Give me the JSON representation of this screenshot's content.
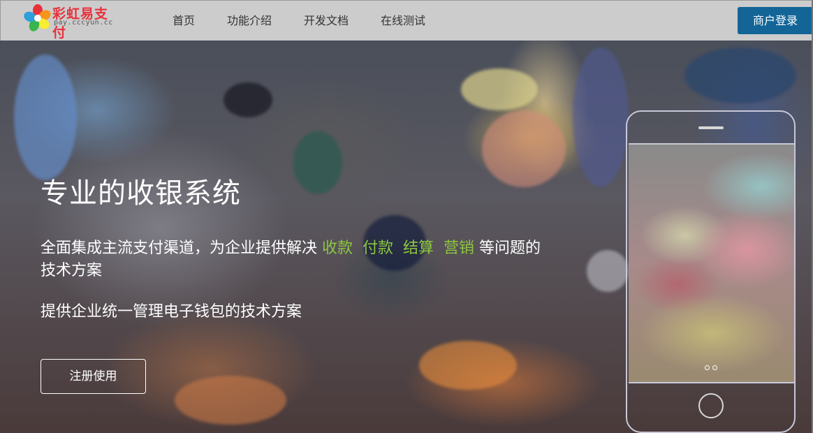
{
  "header": {
    "logo_title": "彩虹易支付",
    "logo_sub": "pay.cccyun.cc",
    "nav": [
      {
        "label": "首页"
      },
      {
        "label": "功能介绍"
      },
      {
        "label": "开发文档"
      },
      {
        "label": "在线测试"
      }
    ],
    "login_label": "商户登录"
  },
  "hero": {
    "title": "专业的收银系统",
    "desc_prefix": "全面集成主流支付渠道，为企业提供解决 ",
    "highlights": [
      "收款",
      "付款",
      "结算",
      "营销"
    ],
    "desc_suffix": " 等问题的技术方案",
    "desc2": "提供企业统一管理电子钱包的技术方案",
    "register_label": "注册使用"
  },
  "colors": {
    "header_bg": "#cccccc",
    "login_btn": "#136597",
    "highlight": "#8dc63f"
  }
}
